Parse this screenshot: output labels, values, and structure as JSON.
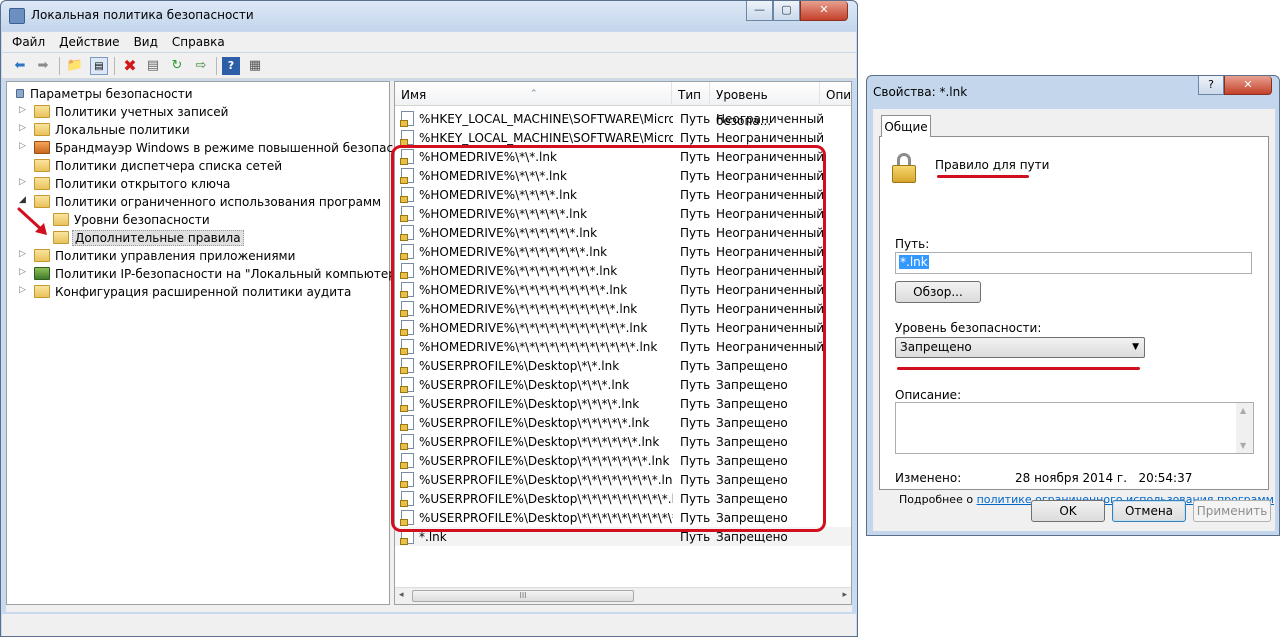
{
  "main_window": {
    "title": "Локальная политика безопасности",
    "controls": {
      "minimize": "—",
      "maximize": "▢",
      "close": "✕"
    }
  },
  "menu": [
    "Файл",
    "Действие",
    "Вид",
    "Справка"
  ],
  "toolbar_icons": [
    "back-arrow-icon",
    "forward-arrow-icon",
    "up-folder-icon",
    "show-hide-tree-icon",
    "delete-icon",
    "properties-icon",
    "refresh-icon",
    "export-list-icon",
    "help-icon",
    "details-view-icon"
  ],
  "tree": {
    "root": "Параметры безопасности",
    "items": [
      {
        "label": "Политики учетных записей",
        "expander": "▷"
      },
      {
        "label": "Локальные политики",
        "expander": "▷"
      },
      {
        "label": "Брандмауэр Windows в режиме повышенной безопасности",
        "expander": "▷"
      },
      {
        "label": "Политики диспетчера списка сетей",
        "expander": ""
      },
      {
        "label": "Политики открытого ключа",
        "expander": "▷"
      },
      {
        "label": "Политики ограниченного использования программ",
        "expander": "◢"
      },
      {
        "label": "Уровни безопасности",
        "expander": ""
      },
      {
        "label": "Дополнительные правила",
        "expander": ""
      },
      {
        "label": "Политики управления приложениями",
        "expander": "▷"
      },
      {
        "label": "Политики IP-безопасности на \"Локальный компьютер\"",
        "expander": "▷"
      },
      {
        "label": "Конфигурация расширенной политики аудита",
        "expander": "▷"
      }
    ]
  },
  "list": {
    "columns": [
      "Имя",
      "Тип",
      "Уровень безопа...",
      "Опи"
    ],
    "rows": [
      {
        "name": "%HKEY_LOCAL_MACHINE\\SOFTWARE\\Micro...",
        "type": "Путь",
        "level": "Неограниченный"
      },
      {
        "name": "%HKEY_LOCAL_MACHINE\\SOFTWARE\\Micro...",
        "type": "Путь",
        "level": "Неограниченный"
      },
      {
        "name": "%HOMEDRIVE%\\*\\*.lnk",
        "type": "Путь",
        "level": "Неограниченный"
      },
      {
        "name": "%HOMEDRIVE%\\*\\*\\*.lnk",
        "type": "Путь",
        "level": "Неограниченный"
      },
      {
        "name": "%HOMEDRIVE%\\*\\*\\*\\*.lnk",
        "type": "Путь",
        "level": "Неограниченный"
      },
      {
        "name": "%HOMEDRIVE%\\*\\*\\*\\*\\*.lnk",
        "type": "Путь",
        "level": "Неограниченный"
      },
      {
        "name": "%HOMEDRIVE%\\*\\*\\*\\*\\*\\*.lnk",
        "type": "Путь",
        "level": "Неограниченный"
      },
      {
        "name": "%HOMEDRIVE%\\*\\*\\*\\*\\*\\*\\*.lnk",
        "type": "Путь",
        "level": "Неограниченный"
      },
      {
        "name": "%HOMEDRIVE%\\*\\*\\*\\*\\*\\*\\*\\*.lnk",
        "type": "Путь",
        "level": "Неограниченный"
      },
      {
        "name": "%HOMEDRIVE%\\*\\*\\*\\*\\*\\*\\*\\*\\*.lnk",
        "type": "Путь",
        "level": "Неограниченный"
      },
      {
        "name": "%HOMEDRIVE%\\*\\*\\*\\*\\*\\*\\*\\*\\*\\*.lnk",
        "type": "Путь",
        "level": "Неограниченный"
      },
      {
        "name": "%HOMEDRIVE%\\*\\*\\*\\*\\*\\*\\*\\*\\*\\*\\*.lnk",
        "type": "Путь",
        "level": "Неограниченный"
      },
      {
        "name": "%HOMEDRIVE%\\*\\*\\*\\*\\*\\*\\*\\*\\*\\*\\*\\*.lnk",
        "type": "Путь",
        "level": "Неограниченный"
      },
      {
        "name": "%USERPROFILE%\\Desktop\\*\\*.lnk",
        "type": "Путь",
        "level": "Запрещено"
      },
      {
        "name": "%USERPROFILE%\\Desktop\\*\\*\\*.lnk",
        "type": "Путь",
        "level": "Запрещено"
      },
      {
        "name": "%USERPROFILE%\\Desktop\\*\\*\\*\\*.lnk",
        "type": "Путь",
        "level": "Запрещено"
      },
      {
        "name": "%USERPROFILE%\\Desktop\\*\\*\\*\\*\\*.lnk",
        "type": "Путь",
        "level": "Запрещено"
      },
      {
        "name": "%USERPROFILE%\\Desktop\\*\\*\\*\\*\\*\\*.lnk",
        "type": "Путь",
        "level": "Запрещено"
      },
      {
        "name": "%USERPROFILE%\\Desktop\\*\\*\\*\\*\\*\\*\\*.lnk",
        "type": "Путь",
        "level": "Запрещено"
      },
      {
        "name": "%USERPROFILE%\\Desktop\\*\\*\\*\\*\\*\\*\\*\\*.lnk",
        "type": "Путь",
        "level": "Запрещено"
      },
      {
        "name": "%USERPROFILE%\\Desktop\\*\\*\\*\\*\\*\\*\\*\\*\\*.lnk",
        "type": "Путь",
        "level": "Запрещено"
      },
      {
        "name": "%USERPROFILE%\\Desktop\\*\\*\\*\\*\\*\\*\\*\\*\\*\\*.lnk",
        "type": "Путь",
        "level": "Запрещено"
      },
      {
        "name": "*.lnk",
        "type": "Путь",
        "level": "Запрещено"
      }
    ],
    "hscroll_grip": "III"
  },
  "dialog": {
    "title": "Свойства: *.lnk",
    "controls": {
      "help": "?",
      "close": "✕"
    },
    "tab": "Общие",
    "rule_type": "Правило для пути",
    "path_label": "Путь:",
    "path_value": "*.lnk",
    "browse_button": "Обзор...",
    "level_label": "Уровень безопасности:",
    "level_value": "Запрещено",
    "description_label": "Описание:",
    "modified_label": "Изменено:",
    "modified_value": "28 ноября 2014 г.   20:54:37",
    "more_prefix": "Подробнее о",
    "more_link": "политике ограниченного использования программ",
    "buttons": {
      "ok": "OK",
      "cancel": "Отмена",
      "apply": "Применить"
    }
  },
  "colors": {
    "annotation_red": "#d20f1e",
    "selection_blue": "#3399ff",
    "link_blue": "#0066cc"
  }
}
